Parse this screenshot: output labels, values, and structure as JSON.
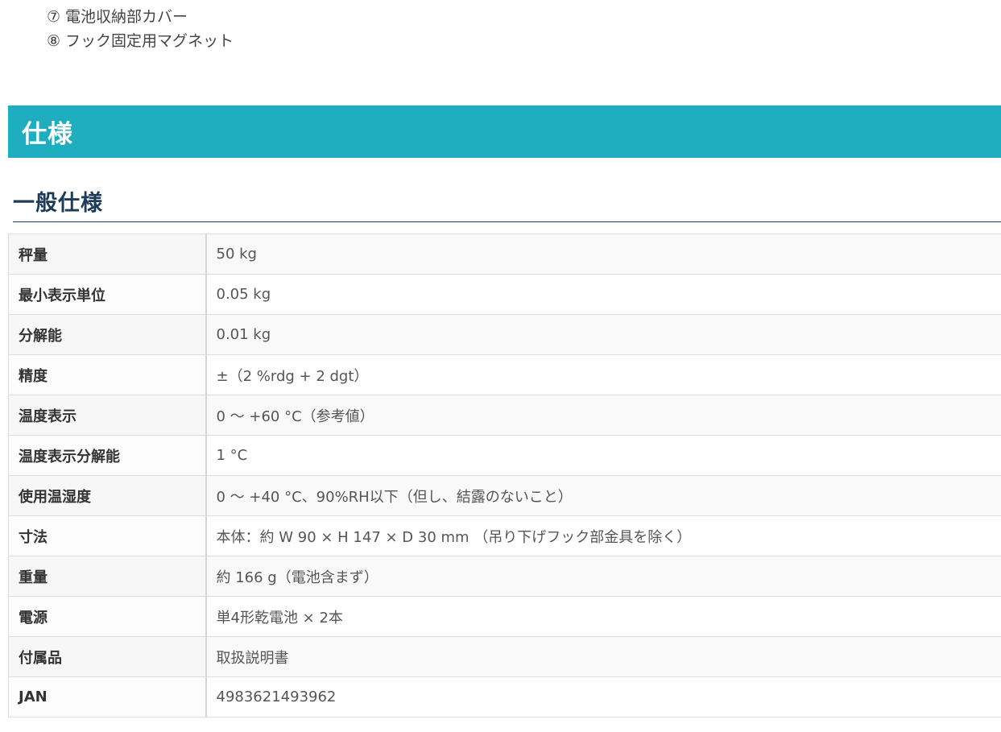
{
  "parts_list": [
    {
      "num": "⑦",
      "label": "電池収納部カバー"
    },
    {
      "num": "⑧",
      "label": "フック固定用マグネット"
    }
  ],
  "section": {
    "title": "仕様"
  },
  "subsection": {
    "title": "一般仕様"
  },
  "spec_table": {
    "rows": [
      {
        "label": "秤量",
        "value": "50 kg"
      },
      {
        "label": "最小表示単位",
        "value": "0.05 kg"
      },
      {
        "label": "分解能",
        "value": "0.01 kg"
      },
      {
        "label": "精度",
        "value": "±（2 %rdg + 2 dgt）"
      },
      {
        "label": "温度表示",
        "value": "0 ～ +60 °C（参考値）"
      },
      {
        "label": "温度表示分解能",
        "value": "1 °C"
      },
      {
        "label": "使用温湿度",
        "value": "0 ～ +40 °C、90%RH以下（但し、結露のないこと）"
      },
      {
        "label": "寸法",
        "value": "本体：約 W 90 × H 147 × D 30 mm （吊り下げフック部金具を除く）"
      },
      {
        "label": "重量",
        "value": "約 166 g（電池含まず）"
      },
      {
        "label": "電源",
        "value": "単4形乾電池 × 2本"
      },
      {
        "label": "付属品",
        "value": "取扱説明書"
      },
      {
        "label": "JAN",
        "value": "4983621493962"
      }
    ]
  },
  "colors": {
    "banner_bg": "#1eaec0",
    "heading_text": "#1d3b57",
    "table_border": "#dddddd"
  }
}
